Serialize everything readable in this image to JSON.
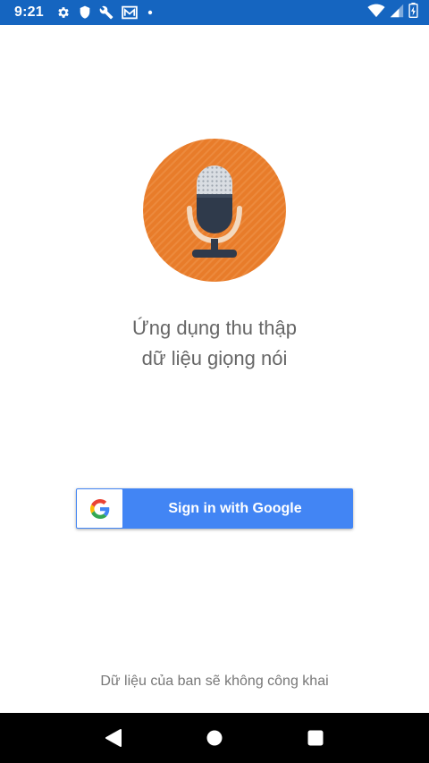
{
  "status_bar": {
    "time": "9:21",
    "left_icons": [
      "gear-icon",
      "shield-icon",
      "wrench-icon",
      "mail-icon",
      "dot-icon"
    ],
    "right_icons": [
      "wifi-icon",
      "signal-icon",
      "battery-icon"
    ]
  },
  "logo": {
    "icon": "microphone-icon",
    "circle_color": "#e87c2a"
  },
  "app": {
    "title_line1": "Ứng dụng thu thập",
    "title_line2": "dữ liệu giọng nói"
  },
  "signin": {
    "label": "Sign in with Google",
    "button_color": "#4285f4",
    "icon": "google-g-icon"
  },
  "footer": {
    "privacy_note": "Dữ liệu của ban sẽ không công khai"
  },
  "nav": {
    "back_icon": "back-triangle-icon",
    "home_icon": "home-circle-icon",
    "recents_icon": "recents-square-icon"
  }
}
